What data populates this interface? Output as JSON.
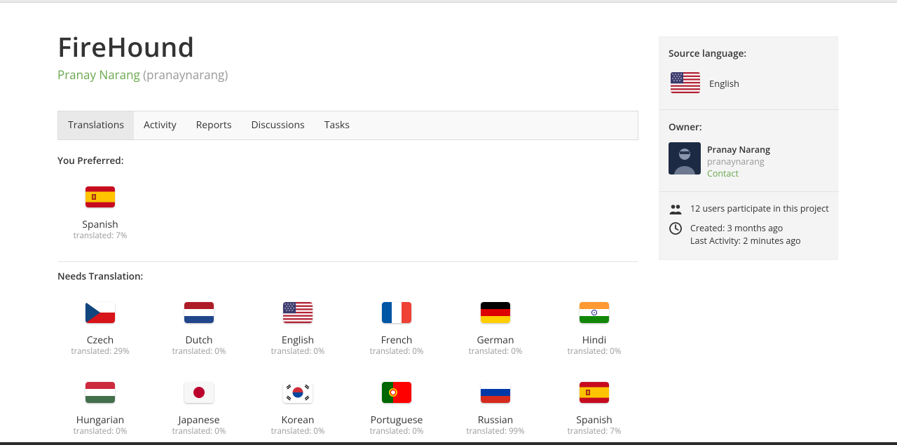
{
  "project": {
    "title": "FireHound",
    "owner_name": "Pranay Narang",
    "owner_username": "(pranaynarang)"
  },
  "tabs": [
    {
      "label": "Translations",
      "active": true
    },
    {
      "label": "Activity"
    },
    {
      "label": "Reports"
    },
    {
      "label": "Discussions"
    },
    {
      "label": "Tasks"
    }
  ],
  "preferred": {
    "title": "You Preferred:",
    "languages": [
      {
        "name": "Spanish",
        "translated": "translated: 7%",
        "flag": "es-flag-icon"
      }
    ]
  },
  "needs": {
    "title": "Needs Translation:",
    "languages": [
      {
        "name": "Czech",
        "translated": "translated: 29%",
        "flag": "cz-flag-icon"
      },
      {
        "name": "Dutch",
        "translated": "translated: 0%",
        "flag": "nl-flag-icon"
      },
      {
        "name": "English",
        "translated": "translated: 0%",
        "flag": "us-flag-icon"
      },
      {
        "name": "French",
        "translated": "translated: 0%",
        "flag": "fr-flag-icon"
      },
      {
        "name": "German",
        "translated": "translated: 0%",
        "flag": "de-flag-icon"
      },
      {
        "name": "Hindi",
        "translated": "translated: 0%",
        "flag": "in-flag-icon"
      },
      {
        "name": "Hungarian",
        "translated": "translated: 0%",
        "flag": "hu-flag-icon"
      },
      {
        "name": "Japanese",
        "translated": "translated: 0%",
        "flag": "jp-flag-icon"
      },
      {
        "name": "Korean",
        "translated": "translated: 0%",
        "flag": "kr-flag-icon"
      },
      {
        "name": "Portuguese",
        "translated": "translated: 0%",
        "flag": "pt-flag-icon"
      },
      {
        "name": "Russian",
        "translated": "translated: 99%",
        "flag": "ru-flag-icon"
      },
      {
        "name": "Spanish",
        "translated": "translated: 7%",
        "flag": "es-flag-icon"
      }
    ]
  },
  "sidebar": {
    "source_label": "Source language:",
    "source_language": "English",
    "owner_label": "Owner:",
    "owner_name": "Pranay Narang",
    "owner_username": "pranaynarang",
    "contact_label": "Contact",
    "participants": "12 users participate in this project",
    "created": "Created: 3 months ago",
    "last_activity": "Last Activity: 2 minutes ago"
  },
  "colors": {
    "accent_green": "#6aa84f",
    "muted_gray": "#9a9a9a",
    "sidebar_bg": "#f4f4f4"
  }
}
